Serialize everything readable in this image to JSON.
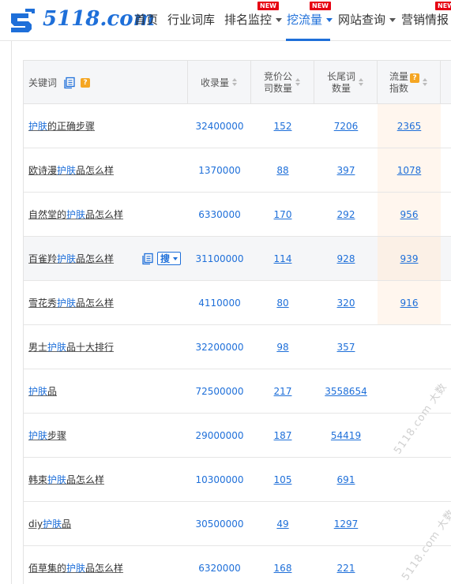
{
  "nav": {
    "logo_text": "5118.com",
    "items": [
      {
        "label": "首页",
        "has_caret": false,
        "new": false
      },
      {
        "label": "行业词库",
        "has_caret": false,
        "new": false
      },
      {
        "label": "排名监控",
        "has_caret": true,
        "new": true
      },
      {
        "label": "挖流量",
        "has_caret": true,
        "new": true,
        "active": true
      },
      {
        "label": "网站查询",
        "has_caret": true,
        "new": false
      },
      {
        "label": "营销情报",
        "has_caret": false,
        "new": true
      }
    ],
    "new_badge": "NEW"
  },
  "table": {
    "headers": {
      "keyword": "关键词",
      "help_mark": "?",
      "index_count": "收录量",
      "competitors_line1": "竞价公",
      "competitors_line2": "司数量",
      "longtail_line1": "长尾词",
      "longtail_line2": "数量",
      "flow_line1": "流量",
      "flow_line2": "指数"
    },
    "search_button": "搜",
    "rows": [
      {
        "pre": "",
        "hl": "护肤",
        "post": "的正确步骤",
        "index": "32400000",
        "comp": "152",
        "longtail": "7206",
        "flow": "2365"
      },
      {
        "pre": "欧诗漫",
        "hl": "护肤",
        "post": "品怎么样",
        "index": "1370000",
        "comp": "88",
        "longtail": "397",
        "flow": "1078"
      },
      {
        "pre": "自然堂的",
        "hl": "护肤",
        "post": "品怎么样",
        "index": "6330000",
        "comp": "170",
        "longtail": "292",
        "flow": "956"
      },
      {
        "pre": "百雀羚",
        "hl": "护肤",
        "post": "品怎么样",
        "index": "31100000",
        "comp": "114",
        "longtail": "928",
        "flow": "939"
      },
      {
        "pre": "雪花秀",
        "hl": "护肤",
        "post": "品怎么样",
        "index": "4110000",
        "comp": "80",
        "longtail": "320",
        "flow": "916"
      },
      {
        "pre": "男士",
        "hl": "护肤",
        "post": "品十大排行",
        "index": "32200000",
        "comp": "98",
        "longtail": "357",
        "flow": ""
      },
      {
        "pre": "",
        "hl": "护肤",
        "post": "品",
        "index": "72500000",
        "comp": "217",
        "longtail": "3558654",
        "flow": ""
      },
      {
        "pre": "",
        "hl": "护肤",
        "post": "步骤",
        "index": "29000000",
        "comp": "187",
        "longtail": "54419",
        "flow": ""
      },
      {
        "pre": "韩束",
        "hl": "护肤",
        "post": "品怎么样",
        "index": "10300000",
        "comp": "105",
        "longtail": "691",
        "flow": ""
      },
      {
        "pre": "diy",
        "hl": "护肤",
        "post": "品",
        "index": "30500000",
        "comp": "49",
        "longtail": "1297",
        "flow": ""
      },
      {
        "pre": "佰草集的",
        "hl": "护肤",
        "post": "品怎么样",
        "index": "6320000",
        "comp": "168",
        "longtail": "221",
        "flow": ""
      }
    ]
  },
  "watermark": "5118.com 大数"
}
